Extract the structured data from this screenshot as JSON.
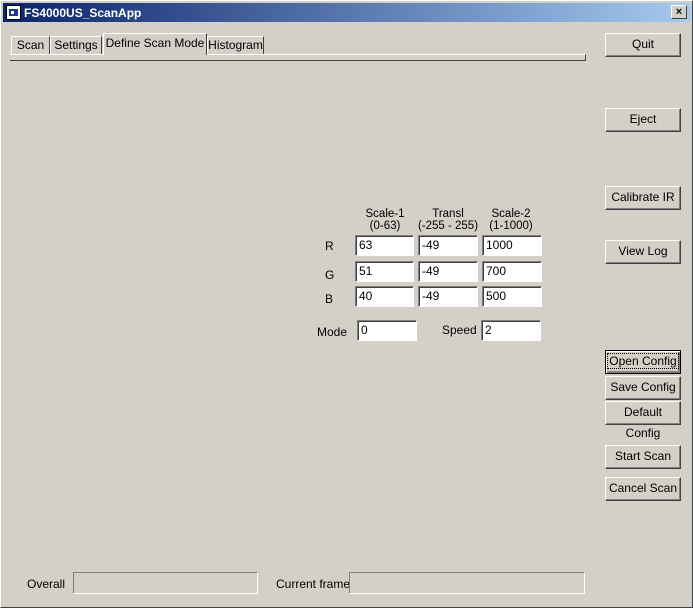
{
  "window": {
    "title": "FS4000US_ScanApp",
    "close_label": "×"
  },
  "tabs": [
    {
      "label": "Scan"
    },
    {
      "label": "Settings"
    },
    {
      "label": "Define Scan Mode"
    },
    {
      "label": "Histogram"
    }
  ],
  "active_tab": "Define Scan Mode",
  "buttons": {
    "quit": "Quit",
    "eject": "Eject",
    "calibrate_ir": "Calibrate IR",
    "view_log": "View Log",
    "open_config": "Open Config",
    "save_config": "Save Config",
    "default_config": "Default Config",
    "start_scan": "Start Scan",
    "cancel_scan": "Cancel Scan"
  },
  "scan_mode": {
    "columns": [
      {
        "title": "Scale-1",
        "range": "(0-63)"
      },
      {
        "title": "Transl",
        "range": "(-255 - 255)"
      },
      {
        "title": "Scale-2",
        "range": "(1-1000)"
      }
    ],
    "rows": [
      {
        "label": "R",
        "values": [
          "63",
          "-49",
          "1000"
        ]
      },
      {
        "label": "G",
        "values": [
          "51",
          "-49",
          "700"
        ]
      },
      {
        "label": "B",
        "values": [
          "40",
          "-49",
          "500"
        ]
      }
    ],
    "mode_label": "Mode",
    "mode_value": "0",
    "speed_label": "Speed",
    "speed_value": "2"
  },
  "status": {
    "overall_label": "Overall",
    "overall_value": "",
    "current_frame_label": "Current frame",
    "current_frame_value": ""
  }
}
